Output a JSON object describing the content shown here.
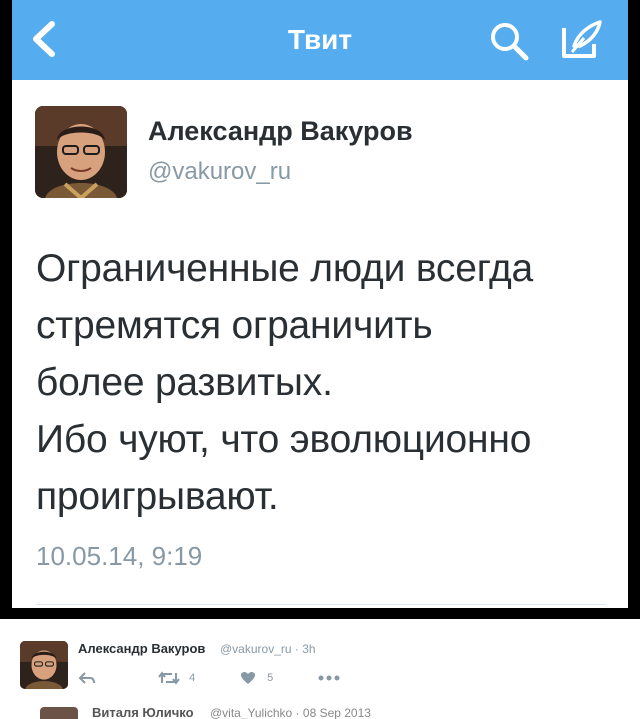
{
  "navbar": {
    "title": "Твит",
    "back_icon": "chevron-left-icon",
    "search_icon": "search-icon",
    "compose_icon": "compose-icon",
    "color": "#55acee"
  },
  "tweet": {
    "author_name": "Александр Вакуров",
    "author_handle": "@vakurov_ru",
    "text": "Ограниченные люди всегда\nстремятся ограничить\nболее развитых.\nИбо чуют, что эволюционно\nпроигрывают.",
    "timestamp": "10.05.14, 9:19"
  },
  "card": {
    "author_name": "Александр Вакуров",
    "meta": "@vakurov_ru · 3h",
    "retweet_count": "4",
    "like_count": "5"
  },
  "ghost_row": {
    "name": "Виталя Юличко",
    "meta": "@vita_Yulichko · 08 Sep 2013"
  }
}
